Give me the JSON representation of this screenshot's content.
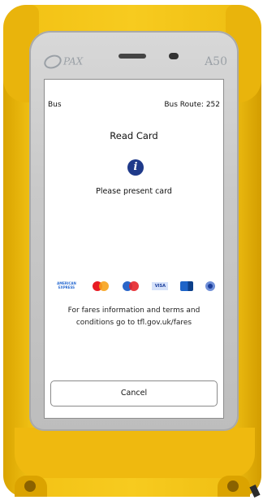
{
  "device": {
    "model_label": "A50",
    "brand_label": "PAX"
  },
  "header": {
    "left_label": "Bus",
    "right_label": "Bus Route: 252"
  },
  "main": {
    "title": "Read Card",
    "prompt": "Please present card",
    "info_glyph": "i",
    "fares_text": "For fares information and terms and conditions go to tfl.gov.uk/fares"
  },
  "card_logos": [
    "american-express",
    "mastercard",
    "maestro",
    "visa",
    "jcb",
    "contactless"
  ],
  "amex_text": "AMERICAN EXPRESS",
  "visa_text": "VISA",
  "actions": {
    "cancel_label": "Cancel"
  },
  "colors": {
    "case_yellow": "#f7cb1f",
    "info_blue": "#1f3a8a",
    "device_grey": "#c9c9c9"
  }
}
